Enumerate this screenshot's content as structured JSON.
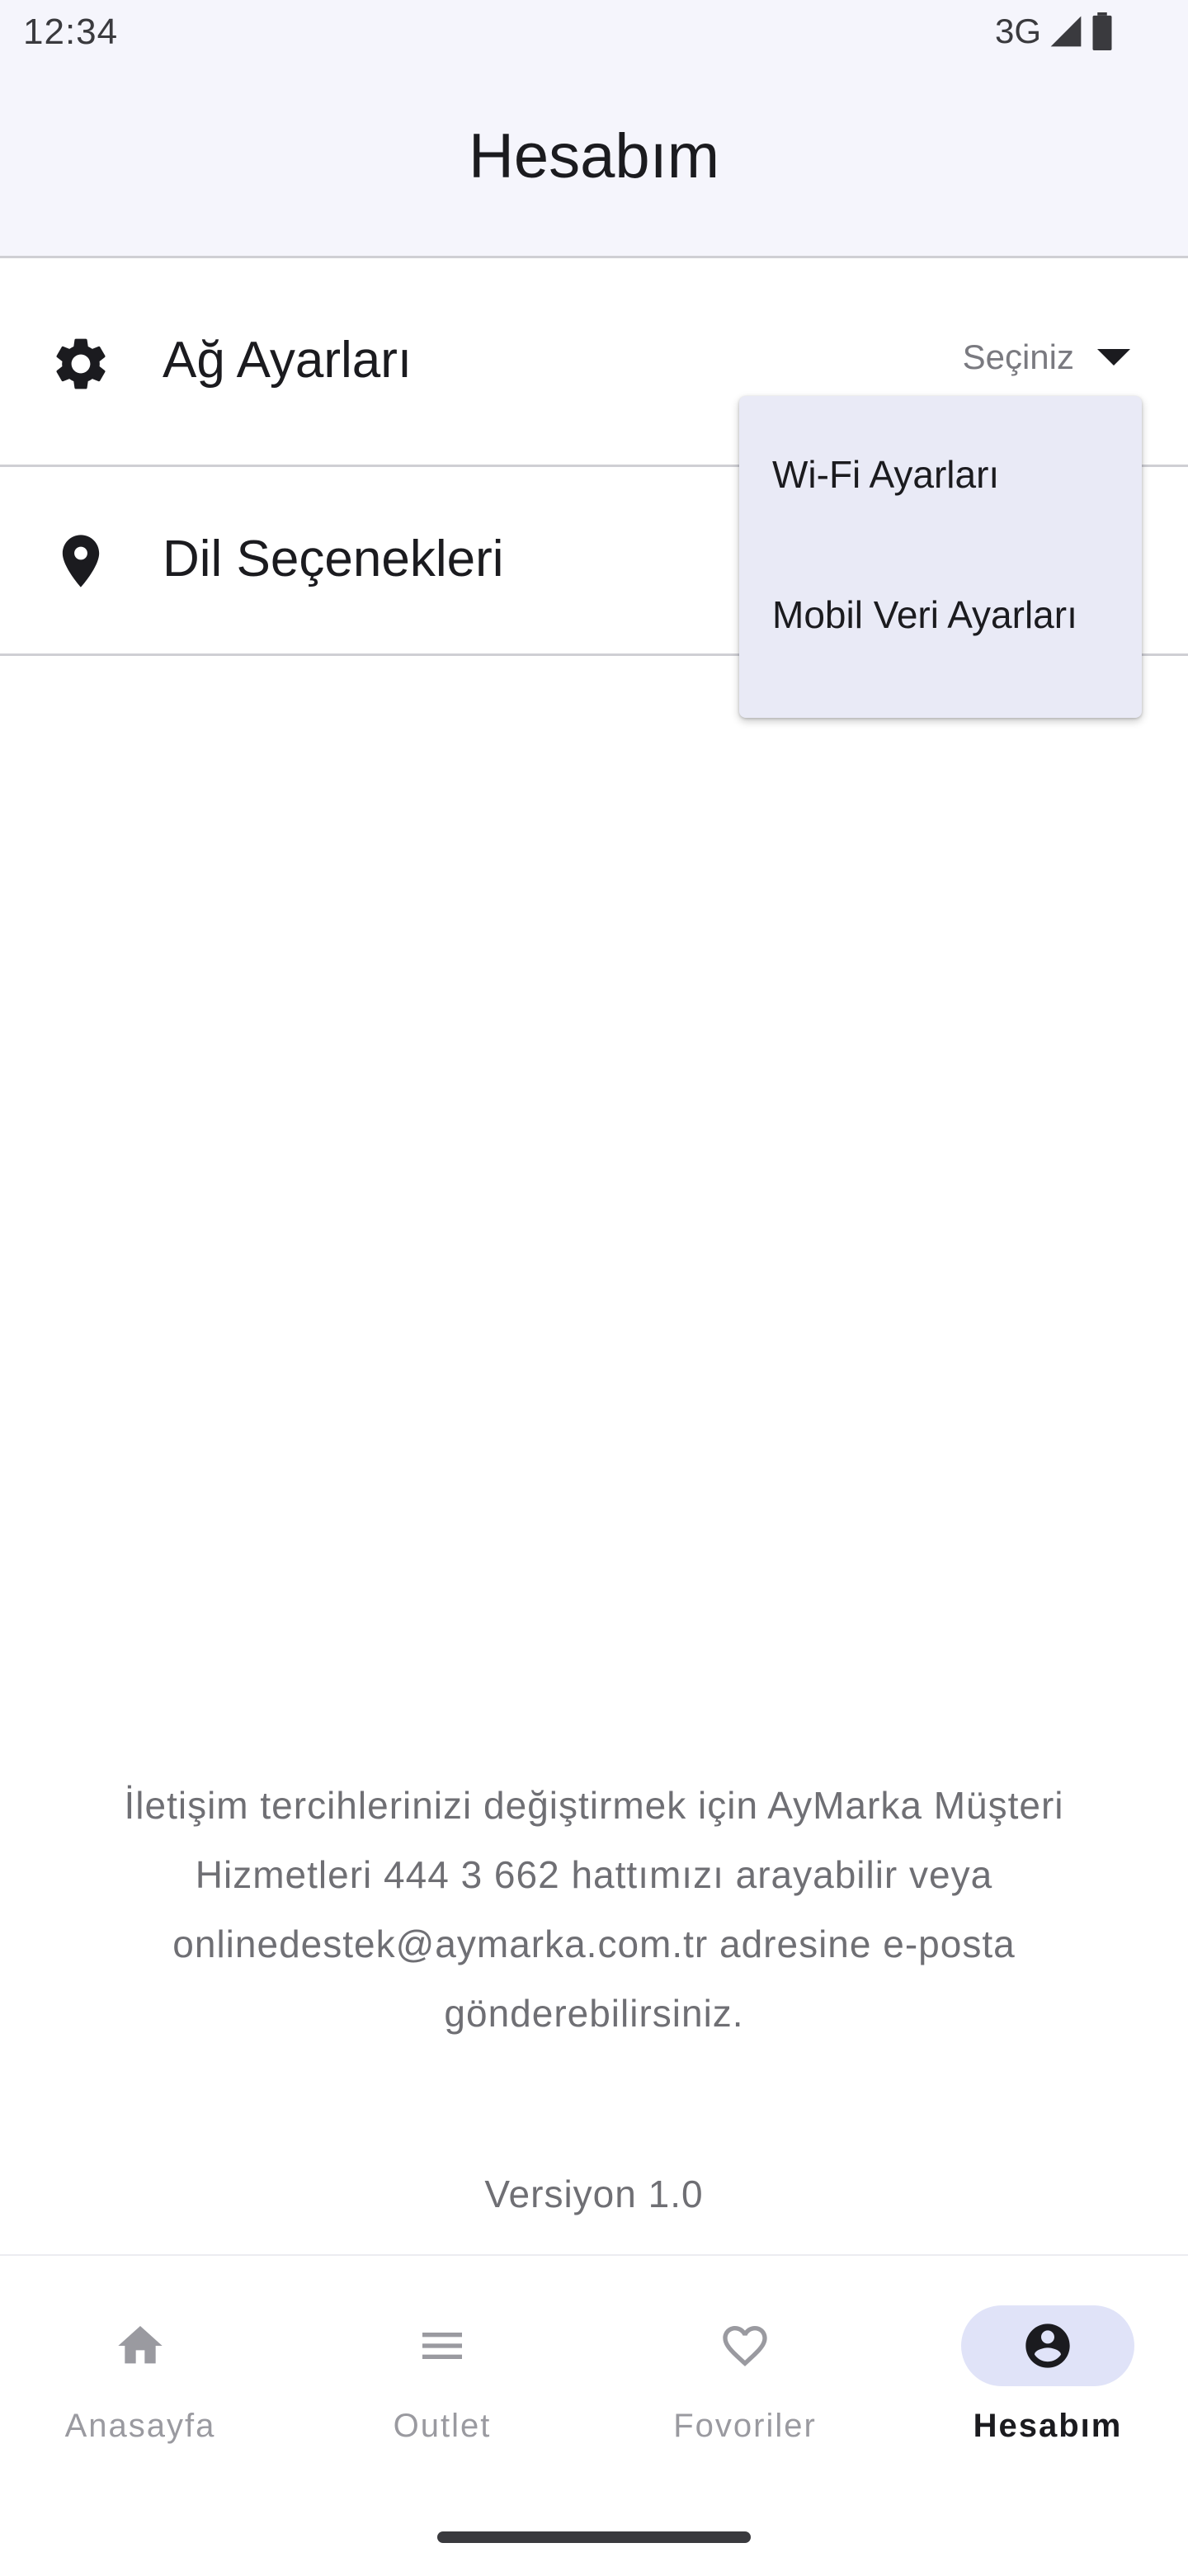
{
  "status_bar": {
    "time": "12:34",
    "network": "3G"
  },
  "header": {
    "title": "Hesabım"
  },
  "settings": {
    "network": {
      "label": "Ağ Ayarları",
      "icon": "gear-icon",
      "dropdown_placeholder": "Seçiniz"
    },
    "language": {
      "label": "Dil Seçenekleri",
      "icon": "location-pin-icon"
    }
  },
  "dropdown_menu": {
    "items": [
      {
        "label": "Wi-Fi Ayarları"
      },
      {
        "label": "Mobil Veri Ayarları"
      }
    ]
  },
  "footer": {
    "info_text": "İletişim tercihlerinizi değiştirmek için AyMarka Müşteri Hizmetleri 444 3 662 hattımızı arayabilir veya onlinedestek@aymarka.com.tr adresine e-posta gönderebilirsiniz.",
    "version": "Versiyon 1.0"
  },
  "bottom_nav": {
    "items": [
      {
        "label": "Anasayfa",
        "icon": "home-icon",
        "active": false
      },
      {
        "label": "Outlet",
        "icon": "menu-lines-icon",
        "active": false
      },
      {
        "label": "Fovoriler",
        "icon": "heart-icon",
        "active": false
      },
      {
        "label": "Hesabım",
        "icon": "account-circle-icon",
        "active": true
      }
    ]
  },
  "colors": {
    "header_bg": "#f5f5fc",
    "menu_bg": "#e9eaf6",
    "active_indicator": "#e0e3f8",
    "text_primary": "#1b1b1f",
    "text_secondary": "#6f6f74",
    "nav_inactive": "#9a9aa0"
  }
}
